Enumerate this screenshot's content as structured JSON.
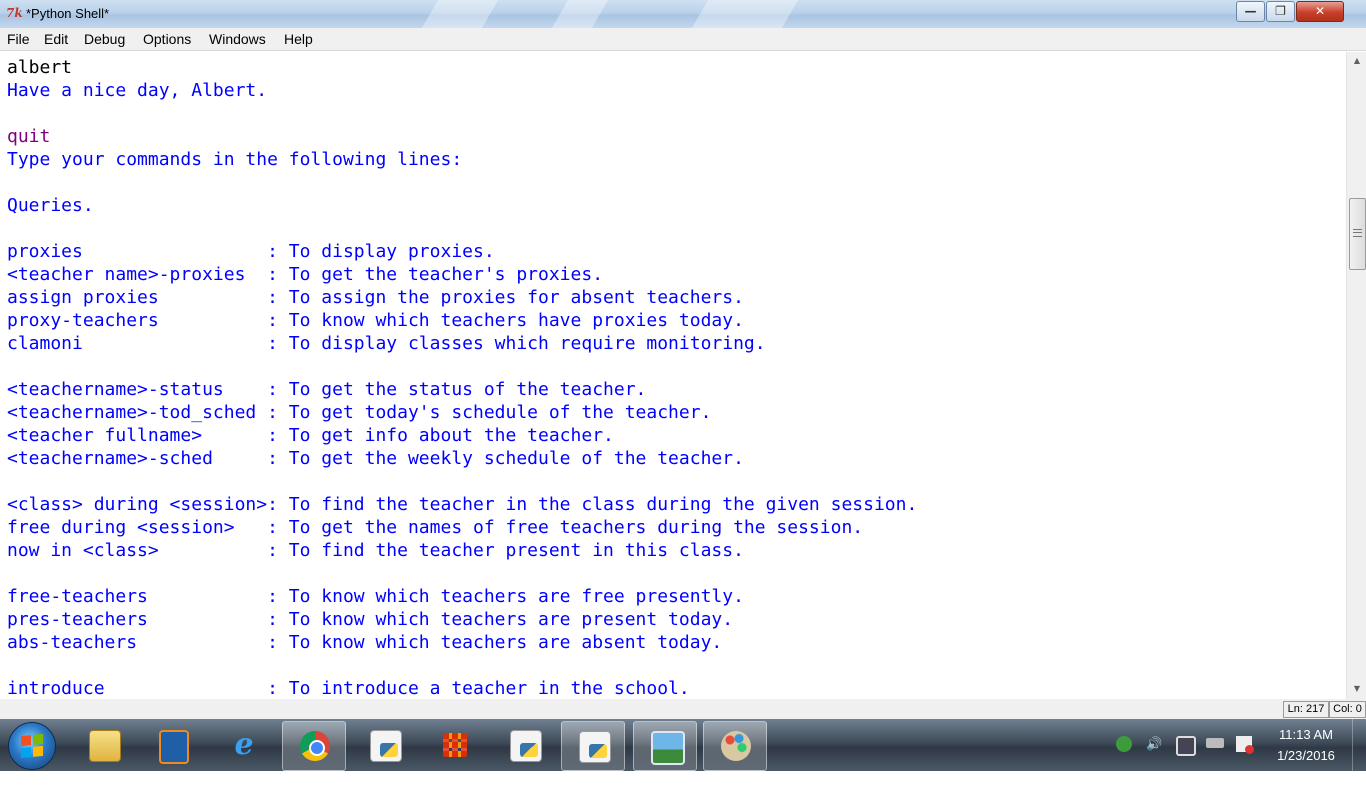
{
  "window": {
    "title": "*Python Shell*",
    "app_icon_glyph": "7k",
    "controls": {
      "minimize": "—",
      "maximize": "❐",
      "close": "✕"
    }
  },
  "menubar": {
    "items": [
      "File",
      "Edit",
      "Debug",
      "Options",
      "Windows",
      "Help"
    ]
  },
  "shell": {
    "lines": [
      {
        "text": "albert",
        "style": "black"
      },
      {
        "text": "Have a nice day, Albert.",
        "style": "blue"
      },
      {
        "text": "",
        "style": "blue"
      },
      {
        "text": "quit",
        "style": "purple"
      },
      {
        "text": "Type your commands in the following lines:",
        "style": "blue"
      },
      {
        "text": "",
        "style": "blue"
      },
      {
        "text": "Queries.",
        "style": "blue"
      },
      {
        "text": "",
        "style": "blue"
      },
      {
        "text": "proxies                 : To display proxies.",
        "style": "blue"
      },
      {
        "text": "<teacher name>-proxies  : To get the teacher's proxies.",
        "style": "blue"
      },
      {
        "text": "assign proxies          : To assign the proxies for absent teachers.",
        "style": "blue"
      },
      {
        "text": "proxy-teachers          : To know which teachers have proxies today.",
        "style": "blue"
      },
      {
        "text": "clamoni                 : To display classes which require monitoring.",
        "style": "blue"
      },
      {
        "text": "",
        "style": "blue"
      },
      {
        "text": "<teachername>-status    : To get the status of the teacher.",
        "style": "blue"
      },
      {
        "text": "<teachername>-tod_sched : To get today's schedule of the teacher.",
        "style": "blue"
      },
      {
        "text": "<teacher fullname>      : To get info about the teacher.",
        "style": "blue"
      },
      {
        "text": "<teachername>-sched     : To get the weekly schedule of the teacher.",
        "style": "blue"
      },
      {
        "text": "",
        "style": "blue"
      },
      {
        "text": "<class> during <session>: To find the teacher in the class during the given session.",
        "style": "blue"
      },
      {
        "text": "free during <session>   : To get the names of free teachers during the session.",
        "style": "blue"
      },
      {
        "text": "now in <class>          : To find the teacher present in this class.",
        "style": "blue"
      },
      {
        "text": "",
        "style": "blue"
      },
      {
        "text": "free-teachers           : To know which teachers are free presently.",
        "style": "blue"
      },
      {
        "text": "pres-teachers           : To know which teachers are present today.",
        "style": "blue"
      },
      {
        "text": "abs-teachers            : To know which teachers are absent today.",
        "style": "blue"
      },
      {
        "text": "",
        "style": "blue"
      },
      {
        "text": "introduce               : To introduce a teacher in the school.",
        "style": "blue"
      }
    ],
    "colors": {
      "blue": "#0000ff",
      "black": "#000000",
      "purple": "#800080"
    }
  },
  "scrollbar": {
    "up_arrow": "▲",
    "down_arrow": "▼"
  },
  "statusbar": {
    "line": "Ln: 217",
    "col": "Col: 0"
  },
  "taskbar": {
    "buttons": [
      {
        "name": "windows-explorer",
        "icon": "folder-icon"
      },
      {
        "name": "media-player",
        "icon": "media-player-icon"
      },
      {
        "name": "internet-explorer",
        "icon": "ie-icon"
      },
      {
        "name": "chrome",
        "icon": "chrome-icon"
      },
      {
        "name": "python-file-1",
        "icon": "python-file-icon"
      },
      {
        "name": "app-grid",
        "icon": "grid-icon"
      },
      {
        "name": "python-file-2",
        "icon": "python-file-icon"
      },
      {
        "name": "python-file-3",
        "icon": "python-file-icon"
      },
      {
        "name": "picture-viewer",
        "icon": "picture-icon"
      },
      {
        "name": "paint",
        "icon": "paint-icon"
      }
    ],
    "clock": {
      "time": "11:13 AM",
      "date": "1/23/2016"
    }
  }
}
